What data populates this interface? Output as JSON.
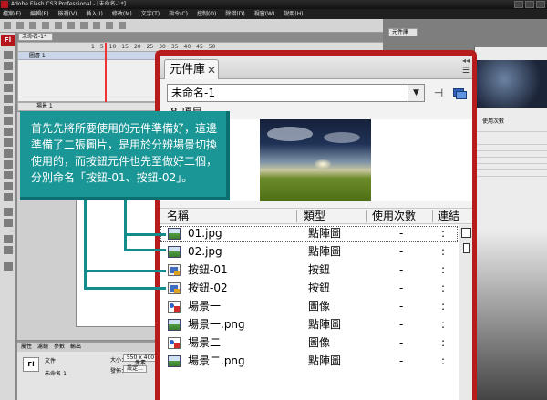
{
  "app": {
    "title": "Adobe Flash CS3 Professional - [未命名-1*]",
    "menu": [
      "檔案(F)",
      "編輯(E)",
      "檢視(V)",
      "插入(I)",
      "修改(M)",
      "文字(T)",
      "指令(C)",
      "控制(O)",
      "除錯(D)",
      "視窗(W)",
      "說明(H)"
    ],
    "logo_text": "Fl"
  },
  "document": {
    "tab_label": "未命名-1*",
    "scene_label": "場景 1",
    "layer_name": "圖層 1",
    "frame_ticks": [
      "1",
      "5",
      "10",
      "15",
      "20",
      "25",
      "30",
      "35",
      "40",
      "45",
      "50"
    ]
  },
  "properties": {
    "tabs": [
      "屬性",
      "濾鏡",
      "參數",
      "輸出"
    ],
    "fi_label": "Fl",
    "doc_label": "文件",
    "doc_name": "未命名-1",
    "size_label": "大小：",
    "size_value": "550 x 400 像素",
    "publish_label": "發佈：",
    "settings_button": "設定..."
  },
  "right_dock": {
    "tab1": "元件庫",
    "tab2": "",
    "header_text": "使用次數"
  },
  "library": {
    "tab_label": "元件庫",
    "document_select": "未命名-1",
    "item_count": "8 項目",
    "columns": {
      "name": "名稱",
      "type": "類型",
      "use_count": "使用次數",
      "linkage": "連結"
    },
    "items": [
      {
        "name": "01.jpg",
        "type": "點陣圖",
        "uses": "-",
        "link": ":",
        "icon": "bitmap-icon"
      },
      {
        "name": "02.jpg",
        "type": "點陣圖",
        "uses": "-",
        "link": ":",
        "icon": "bitmap-icon"
      },
      {
        "name": "按鈕-01",
        "type": "按鈕",
        "uses": "-",
        "link": ":",
        "icon": "button-symbol-icon"
      },
      {
        "name": "按鈕-02",
        "type": "按鈕",
        "uses": "-",
        "link": ":",
        "icon": "button-symbol-icon"
      },
      {
        "name": "場景一",
        "type": "圖像",
        "uses": "-",
        "link": ":",
        "icon": "graphic-symbol-icon"
      },
      {
        "name": "場景一.png",
        "type": "點陣圖",
        "uses": "-",
        "link": ":",
        "icon": "bitmap-icon"
      },
      {
        "name": "場景二",
        "type": "圖像",
        "uses": "-",
        "link": ":",
        "icon": "graphic-symbol-icon"
      },
      {
        "name": "場景二.png",
        "type": "點陣圖",
        "uses": "-",
        "link": ":",
        "icon": "bitmap-icon"
      }
    ]
  },
  "callout": {
    "text": "首先先將所要使用的元件準備好，這邊準備了二張圖片，是用於分辨場景切換使用的，而按鈕元件也先至做好二個，分別命名「按鈕-01、按鈕-02」。"
  },
  "colors": {
    "library_frame": "#b61c1c",
    "callout_bg": "#1a9696",
    "connector": "#158c8c"
  }
}
